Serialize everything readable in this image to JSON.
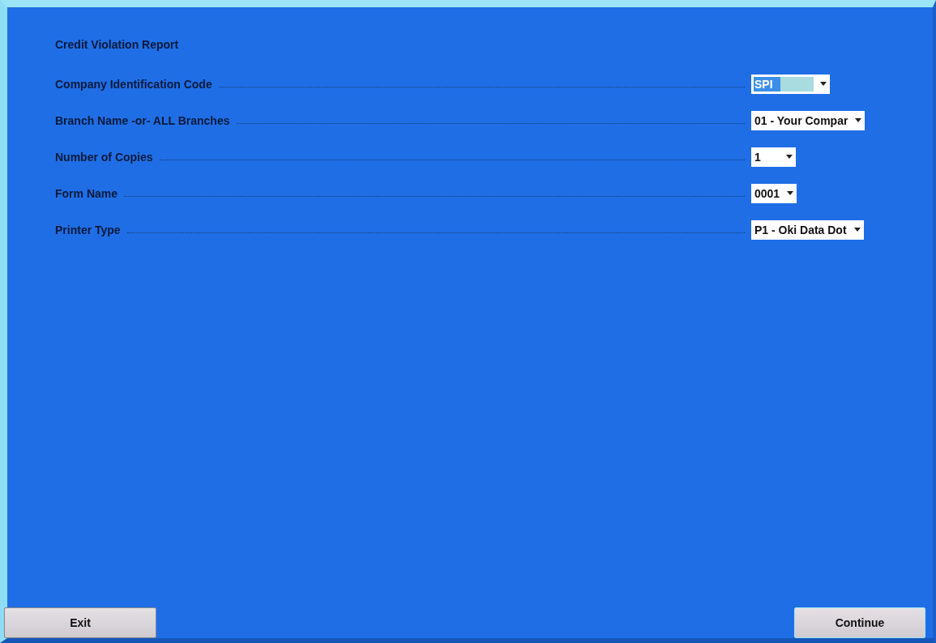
{
  "title": "Credit Violation Report",
  "fields": [
    {
      "label": "Company Identification Code",
      "value": "SPI",
      "text_selected": true
    },
    {
      "label": "Branch Name -or- ALL Branches",
      "value": "01 - Your Compar",
      "text_selected": false
    },
    {
      "label": "Number of Copies",
      "value": "1",
      "text_selected": false
    },
    {
      "label": "Form Name",
      "value": "0001",
      "text_selected": false
    },
    {
      "label": "Printer Type",
      "value": "P1 - Oki Data Dot",
      "text_selected": false
    }
  ],
  "buttons": [
    {
      "label": "Exit"
    },
    {
      "label": "Continue"
    }
  ]
}
